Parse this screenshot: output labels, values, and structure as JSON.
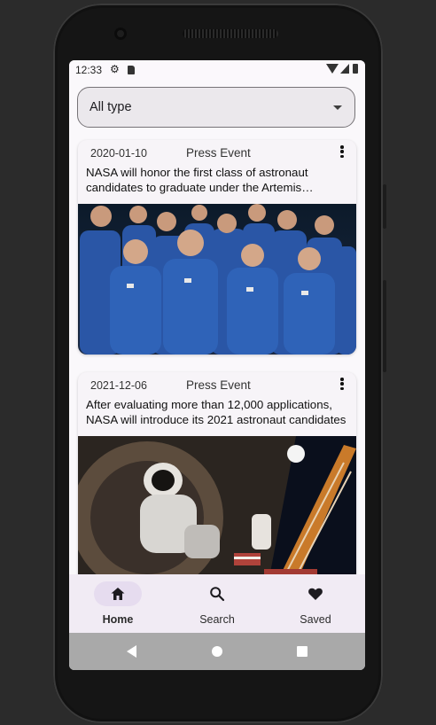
{
  "status_bar": {
    "time": "12:33",
    "icons": [
      "gear-icon",
      "sd-card-icon",
      "wifi-icon",
      "signal-icon",
      "battery-icon"
    ]
  },
  "filter": {
    "selected": "All type",
    "icon": "dropdown-arrow-icon"
  },
  "events": [
    {
      "date": "2020-01-10",
      "type": "Press Event",
      "title": "NASA will honor the first class of astronaut candidates to graduate under the Artemis program",
      "image": "astronaut-class-group-photo"
    },
    {
      "date": "2021-12-06",
      "type": "Press Event",
      "title": "After evaluating more than 12,000 applications, NASA will introduce its 2021 astronaut candidates",
      "image": "spacewalk-astronaut-photo"
    }
  ],
  "bottom_nav": [
    {
      "label": "Home",
      "icon": "home-icon",
      "active": true
    },
    {
      "label": "Search",
      "icon": "search-icon",
      "active": false
    },
    {
      "label": "Saved",
      "icon": "heart-icon",
      "active": false
    }
  ],
  "colors": {
    "accent": "#e6dcef",
    "nav_background": "#f1ebf4",
    "screen_background": "#faf8fb"
  }
}
